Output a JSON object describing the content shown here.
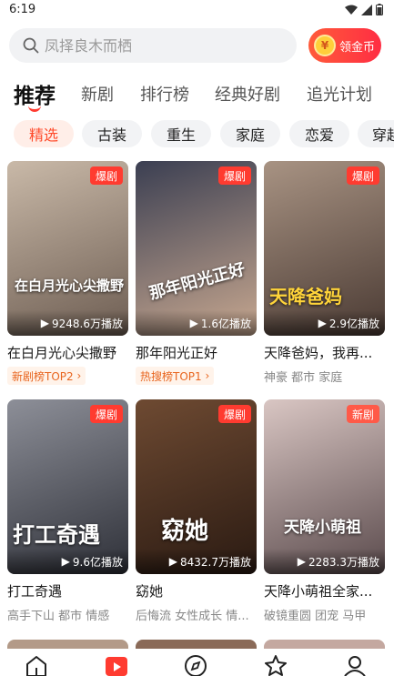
{
  "status_bar": {
    "time": "6:19"
  },
  "search": {
    "placeholder": "凤择良木而栖",
    "coin_button": "领金币",
    "coin_icon_char": "¥"
  },
  "main_tabs": [
    {
      "label": "推荐",
      "active": true
    },
    {
      "label": "新剧",
      "active": false
    },
    {
      "label": "排行榜",
      "active": false
    },
    {
      "label": "经典好剧",
      "active": false
    },
    {
      "label": "追光计划",
      "active": false
    }
  ],
  "chips": [
    {
      "label": "精选",
      "active": true
    },
    {
      "label": "古装",
      "active": false
    },
    {
      "label": "重生",
      "active": false
    },
    {
      "label": "家庭",
      "active": false
    },
    {
      "label": "恋爱",
      "active": false
    },
    {
      "label": "穿越",
      "active": false
    }
  ],
  "dramas": [
    {
      "title": "在白月光心尖撒野",
      "badge": "爆剧",
      "plays": "9248.6万播放",
      "poster_text": "在白月光心尖撒野",
      "rank": "新剧榜TOP2",
      "tags": "",
      "colors": [
        "#c9b9a8",
        "#6d5d52"
      ]
    },
    {
      "title": "那年阳光正好",
      "badge": "爆剧",
      "plays": "1.6亿播放",
      "poster_text": "那年阳光正好",
      "rank": "热搜榜TOP1",
      "tags": "",
      "colors": [
        "#3b3f52",
        "#c8a890"
      ]
    },
    {
      "title": "天降爸妈，我再...",
      "badge": "爆剧",
      "plays": "2.9亿播放",
      "poster_text": "天降爸妈",
      "rank": "",
      "tags": "神豪 都市 家庭",
      "colors": [
        "#a89383",
        "#4a3a33"
      ]
    },
    {
      "title": "打工奇遇",
      "badge": "爆剧",
      "plays": "9.6亿播放",
      "poster_text": "打工奇遇",
      "rank": "",
      "tags": "高手下山 都市 情感",
      "colors": [
        "#8d8f98",
        "#2e3038"
      ]
    },
    {
      "title": "窈她",
      "badge": "爆剧",
      "plays": "8432.7万播放",
      "poster_text": "窈她",
      "rank": "",
      "tags": "后悔流 女性成长 情...",
      "colors": [
        "#6e4a32",
        "#2a1a12"
      ]
    },
    {
      "title": "天降小萌祖全家...",
      "badge": "新剧",
      "plays": "2283.3万播放",
      "poster_text": "天降小萌祖",
      "rank": "",
      "tags": "破镜重圆 团宠 马甲",
      "colors": [
        "#d9c6c3",
        "#5a4a4c"
      ]
    }
  ],
  "bottom_nav": [
    {
      "name": "home-icon"
    },
    {
      "name": "theater-icon"
    },
    {
      "name": "discover-icon"
    },
    {
      "name": "welfare-icon"
    },
    {
      "name": "profile-icon"
    }
  ]
}
